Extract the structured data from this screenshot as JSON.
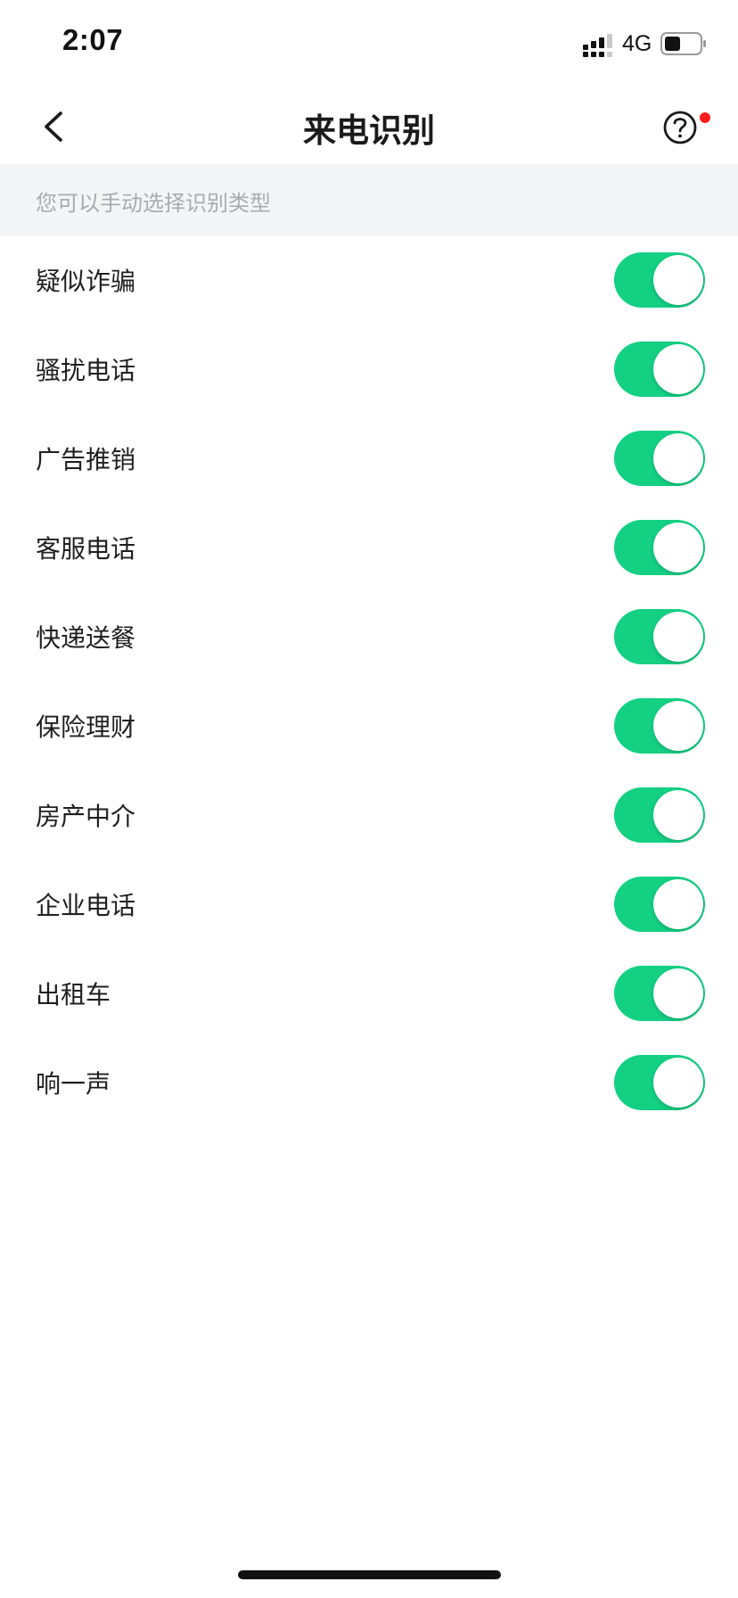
{
  "status_bar": {
    "time": "2:07",
    "network": "4G"
  },
  "nav": {
    "title": "来电识别",
    "back_icon": "chevron-left-icon",
    "help_icon": "question-circle-icon",
    "help_badge_color": "#ff1c1c"
  },
  "hint": {
    "text": "您可以手动选择识别类型"
  },
  "accent_color": "#13d083",
  "items": [
    {
      "label": "疑似诈骗",
      "enabled": true
    },
    {
      "label": "骚扰电话",
      "enabled": true
    },
    {
      "label": "广告推销",
      "enabled": true
    },
    {
      "label": "客服电话",
      "enabled": true
    },
    {
      "label": "快递送餐",
      "enabled": true
    },
    {
      "label": "保险理财",
      "enabled": true
    },
    {
      "label": "房产中介",
      "enabled": true
    },
    {
      "label": "企业电话",
      "enabled": true
    },
    {
      "label": "出租车",
      "enabled": true
    },
    {
      "label": "响一声",
      "enabled": true
    }
  ]
}
